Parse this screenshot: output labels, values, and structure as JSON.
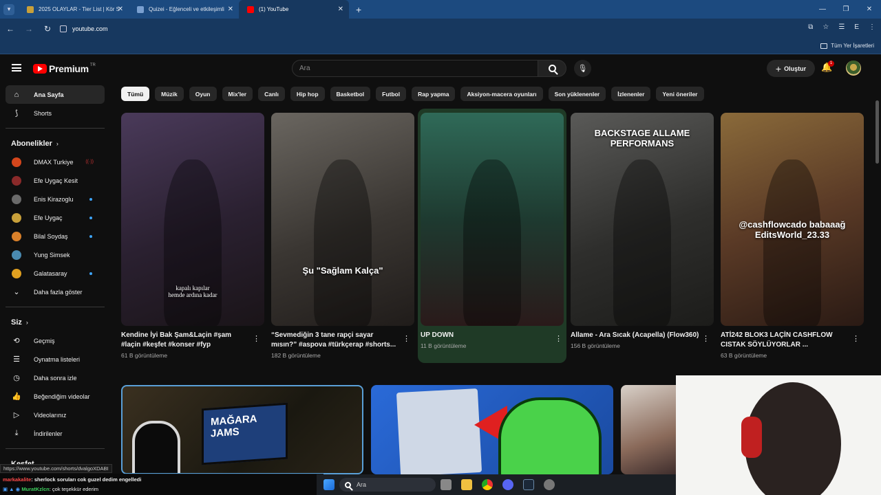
{
  "browser": {
    "tabs": [
      {
        "title": "2025 OLAYLAR - Tier List | Kör S",
        "active": false
      },
      {
        "title": "Quizei - Eğlenceli ve etkileşimli",
        "active": false
      },
      {
        "title": "(1) YouTube",
        "active": true
      }
    ],
    "url": "youtube.com",
    "bookmarks_label": "Tüm Yer İşaretleri",
    "profile_initial": "E"
  },
  "youtube": {
    "logo_text": "Premium",
    "logo_sup": "TR",
    "search_placeholder": "Ara",
    "create_label": "Oluştur",
    "notif_count": "1",
    "sidebar": {
      "main": [
        {
          "label": "Ana Sayfa",
          "icon": "home-icon",
          "active": true
        },
        {
          "label": "Shorts",
          "icon": "shorts-icon",
          "active": false
        }
      ],
      "subs_heading": "Abonelikler",
      "subs": [
        {
          "label": "DMAX Turkiye",
          "color": "#d4461c",
          "marker": "live"
        },
        {
          "label": "Efe Uygaç Kesit",
          "color": "#8a2a2a",
          "marker": ""
        },
        {
          "label": "Enis Kirazoglu",
          "color": "#6a6a6a",
          "marker": "dot"
        },
        {
          "label": "Efe Uygaç",
          "color": "#c8a03a",
          "marker": "dot"
        },
        {
          "label": "Bilal Soydaş",
          "color": "#d9802a",
          "marker": "dot"
        },
        {
          "label": "Yung Simsek",
          "color": "#4a8ab0",
          "marker": ""
        },
        {
          "label": "Galatasaray",
          "color": "#e0a020",
          "marker": "dot"
        }
      ],
      "more_label": "Daha fazla göster",
      "you_heading": "Siz",
      "you": [
        {
          "label": "Geçmiş",
          "icon": "history-icon"
        },
        {
          "label": "Oynatma listeleri",
          "icon": "playlist-icon"
        },
        {
          "label": "Daha sonra izle",
          "icon": "clock-icon"
        },
        {
          "label": "Beğendiğim videolar",
          "icon": "like-icon"
        },
        {
          "label": "Videolarınız",
          "icon": "video-icon"
        },
        {
          "label": "İndirilenler",
          "icon": "download-icon"
        }
      ],
      "explore_heading": "Keşfet"
    },
    "chips": [
      "Tümü",
      "Müzik",
      "Oyun",
      "Mix'ler",
      "Canlı",
      "Hip hop",
      "Basketbol",
      "Futbol",
      "Rap yapma",
      "Aksiyon-macera oyunları",
      "Son yüklenenler",
      "İzlenenler",
      "Yeni öneriler"
    ],
    "shorts": [
      {
        "title": "Kendine İyi Bak Şam&Laçin #şam #laçin #keşfet #konser #fyp",
        "views": "61 B görüntüleme",
        "overlay": "kapalı kapılar\nhemde ardına kadar",
        "bg": "linear-gradient(160deg,#4a3a5a,#2a2030 55%,#1a1418)"
      },
      {
        "title": "“Sevmediğin 3 tane rapçi sayar mısın?” #aspova #türkçerap #shorts...",
        "views": "182 B görüntüleme",
        "overlay": "Şu \"Sağlam Kalça\"",
        "bg": "linear-gradient(160deg,#6a6660,#3a3632 55%,#201c1a)"
      },
      {
        "title": "UP DOWN",
        "views": "11 B görüntüleme",
        "overlay": "",
        "bg": "linear-gradient(180deg,#2f6a58,#1e3a30 50%,#2a1a1a)"
      },
      {
        "title": "Allame - Ara Sıcak (Acapella) (Flow360)",
        "views": "156 B görüntüleme",
        "overlay": "BACKSTAGE ALLAME\nPERFORMANS",
        "bg": "linear-gradient(160deg,#5a5a58,#2e2e2c 55%,#1c1c1a)"
      },
      {
        "title": "ATİ242 BLOK3 LAÇİN CASHFLOW CISTAK SÖYLÜYORLAR ...",
        "views": "63 B görüntüleme",
        "overlay": "@cashflowcado babaaağ\nEditsWorld_23.33",
        "bg": "linear-gradient(160deg,#8a6a3a,#5a3a26 50%,#2a1a14)"
      }
    ],
    "row2_overlay": "MAĞARA\nJAMS"
  },
  "overlay": {
    "status_url": "https://www.youtube.com/shorts/dvalgoXDABI",
    "chat": [
      {
        "user": "markakalite",
        "text": ": sherlock soruları cok guzel dedim engelledi",
        "user_color": "#ff4a4a"
      },
      {
        "user": "MuratKzlcn",
        "text": ": çok teşekkür ederim",
        "user_color": "#3ecf5e"
      }
    ]
  },
  "taskbar": {
    "search_label": "Ara"
  }
}
